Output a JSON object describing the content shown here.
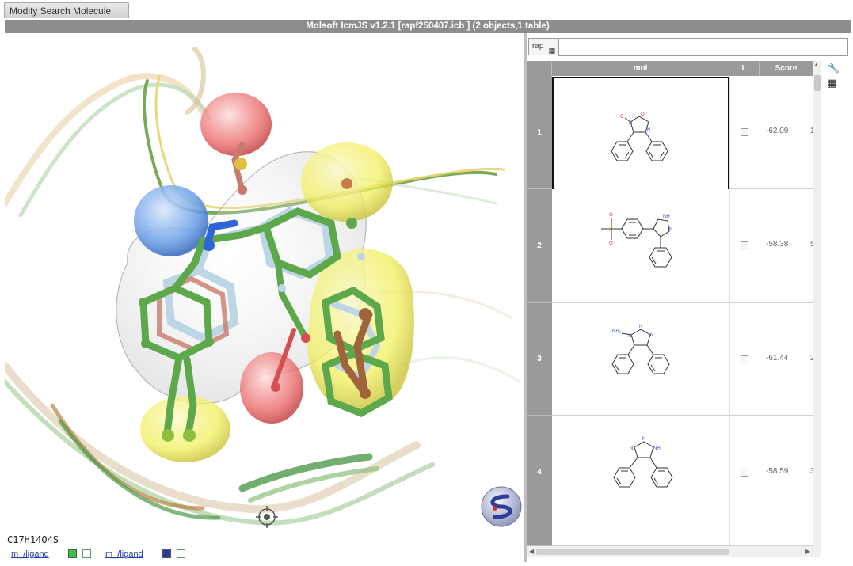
{
  "window": {
    "tab_label": "Modify Search Molecule",
    "title": "Molsoft IcmJS v1.2.1 [rapf250407.icb ] (2 objects,1 table)"
  },
  "viewer": {
    "formula": "C17H14O4S",
    "ligands": [
      {
        "label": "m_/ligand",
        "swatch_color": "#3ec13e"
      },
      {
        "label": "m_/ligand",
        "swatch_color": "#2b3c9e"
      }
    ]
  },
  "table": {
    "tab_label": "rap",
    "columns": [
      "mol",
      "L",
      "Score"
    ],
    "rows": [
      {
        "index": "1",
        "score": "-62.09",
        "extra": "1"
      },
      {
        "index": "2",
        "score": "-58.38",
        "extra": "5"
      },
      {
        "index": "3",
        "score": "-61.44",
        "extra": "2"
      },
      {
        "index": "4",
        "score": "-58.59",
        "extra": "3"
      }
    ]
  },
  "colors": {
    "title_bar": "#8d8d8d",
    "ligand_green": "#5aa048",
    "ligand_brown": "#a0643a",
    "blob_yellow": "#f2f06a",
    "blob_red": "#e85a5a",
    "blob_blue": "#5a8ee0"
  }
}
